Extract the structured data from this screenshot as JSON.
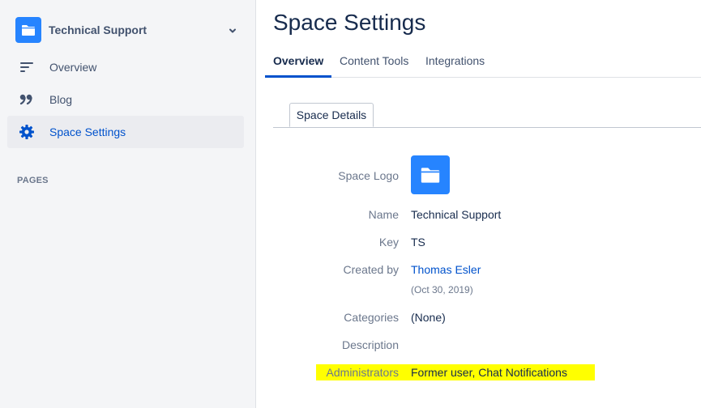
{
  "sidebar": {
    "space_name": "Technical Support",
    "items": [
      {
        "label": "Overview",
        "icon": "overview-lines-icon"
      },
      {
        "label": "Blog",
        "icon": "quote-icon"
      },
      {
        "label": "Space Settings",
        "icon": "gear-icon",
        "active": true
      }
    ],
    "pages_heading": "PAGES"
  },
  "main": {
    "title": "Space Settings",
    "tabs": [
      {
        "label": "Overview",
        "active": true
      },
      {
        "label": "Content Tools"
      },
      {
        "label": "Integrations"
      }
    ],
    "subtab": "Space Details",
    "details": {
      "logo_label": "Space Logo",
      "name_label": "Name",
      "name_value": "Technical Support",
      "key_label": "Key",
      "key_value": "TS",
      "created_label": "Created by",
      "created_by": "Thomas Esler",
      "created_date": "(Oct 30, 2019)",
      "categories_label": "Categories",
      "categories_value": "(None)",
      "description_label": "Description",
      "admins_label": "Administrators",
      "admins_value": "Former user, Chat Notifications"
    }
  },
  "colors": {
    "accent": "#0052cc",
    "space_icon": "#2684ff",
    "highlight": "#ffff00"
  }
}
